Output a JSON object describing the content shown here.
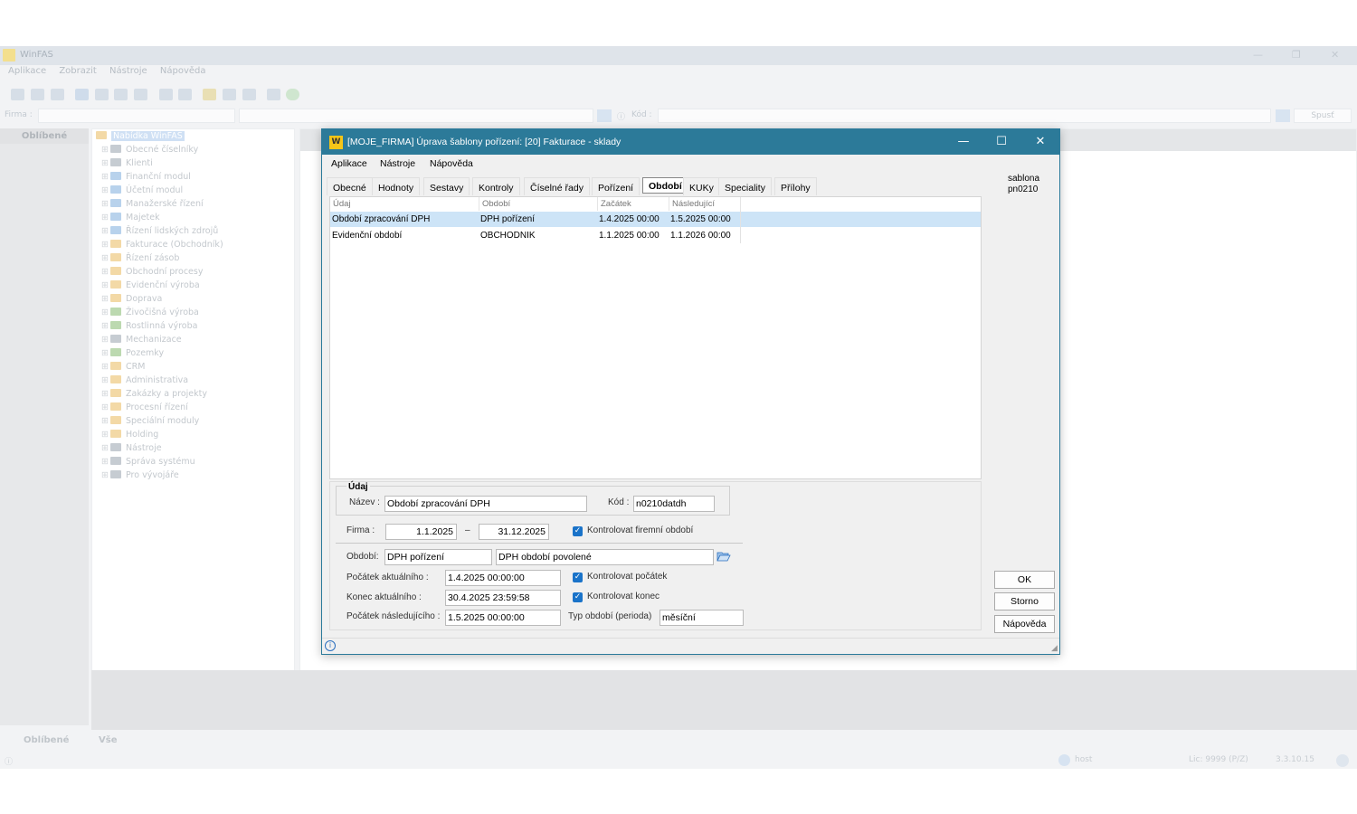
{
  "bg_app": {
    "title": "WinFAS",
    "menu": [
      "Aplikace",
      "Zobrazit",
      "Nástroje",
      "Nápověda"
    ],
    "firma_label": "Firma :",
    "kod_label": "Kód :",
    "spust_label": "Spusť",
    "favorites_header": "Oblíbené",
    "tree_root": "Nabídka WinFAS",
    "tree_items": [
      "Obecné číselníky",
      "Klienti",
      "Finanční modul",
      "Účetní modul",
      "Manažerské řízení",
      "Majetek",
      "Řízení lidských zdrojů",
      "Fakturace (Obchodník)",
      "Řízení zásob",
      "Obchodní procesy",
      "Evidenční výroba",
      "Doprava",
      "Živočišná výroba",
      "Rostlinná výroba",
      "Mechanizace",
      "Pozemky",
      "CRM",
      "Administrativa",
      "Zakázky a projekty",
      "Procesní řízení",
      "Speciální moduly",
      "Holding",
      "Nástroje",
      "Správa systému",
      "Pro vývojáře"
    ],
    "bottom_tabs": [
      "Oblíbené",
      "Vše"
    ],
    "status_user": "host",
    "status_lic": "Lic: 9999 (P/Z)",
    "status_version": "3.3.10.15",
    "colors": {
      "folder_grey": "#c6ccd2",
      "folder_blue": "#b8d2ec",
      "folder_orange": "#f3d9a6",
      "folder_green": "#bcd9b0"
    }
  },
  "dialog": {
    "title": "[MOJE_FIRMA] Úprava šablony pořízení: [20] Fakturace - sklady",
    "logo": "W",
    "window_controls": {
      "minimize": "—",
      "maximize": "☐",
      "close": "✕"
    },
    "menu": [
      "Aplikace",
      "Nástroje",
      "Nápověda"
    ],
    "tabs": [
      "Obecné",
      "Hodnoty",
      "Sestavy",
      "Kontroly",
      "Číselné řady",
      "Pořízení",
      "Období",
      "KUKy",
      "Speciality",
      "Přílohy"
    ],
    "active_tab": "Období",
    "grid": {
      "headers": [
        "Údaj",
        "Období",
        "Začátek",
        "Následující"
      ],
      "rows": [
        {
          "udaj": "Období zpracování DPH",
          "obdobi": "DPH pořízení",
          "zacatek": "1.4.2025 00:00",
          "nasledujici": "1.5.2025 00:00",
          "selected": true
        },
        {
          "udaj": "Evidenční období",
          "obdobi": "OBCHODNIK",
          "zacatek": "1.1.2025 00:00",
          "nasledujici": "1.1.2026 00:00",
          "selected": false
        }
      ]
    },
    "detail": {
      "group_label": "Údaj",
      "nazev_label": "Název :",
      "nazev_value": "Období zpracování DPH",
      "kod_label": "Kód :",
      "kod_value": "n0210datdh",
      "firma_label": "Firma :",
      "firma_from": "1.1.2025",
      "firma_dash": "–",
      "firma_to": "31.12.2025",
      "kontrolovat_firemni": "Kontrolovat firemní období",
      "obdobi_label": "Období:",
      "obdobi_value": "DPH pořízení",
      "obdobi_desc": "DPH období povolené",
      "pocatek_akt_label": "Počátek aktuálního :",
      "pocatek_akt_value": "1.4.2025 00:00:00",
      "kontrolovat_pocatek": "Kontrolovat počátek",
      "konec_akt_label": "Konec aktuálního :",
      "konec_akt_value": "30.4.2025 23:59:58",
      "kontrolovat_konec": "Kontrolovat konec",
      "pocatek_nasl_label": "Počátek následujícího :",
      "pocatek_nasl_value": "1.5.2025 00:00:00",
      "typ_obdobi_label": "Typ období (perioda)",
      "typ_obdobi_value": "měsíční"
    },
    "side": {
      "line1": "sablona",
      "line2": "pn0210"
    },
    "buttons": {
      "ok": "OK",
      "storno": "Storno",
      "napoveda": "Nápověda"
    },
    "colors": {
      "title_bar": "#2c7a99",
      "selection": "#cde4f7",
      "checkbox": "#1a73c9"
    }
  }
}
